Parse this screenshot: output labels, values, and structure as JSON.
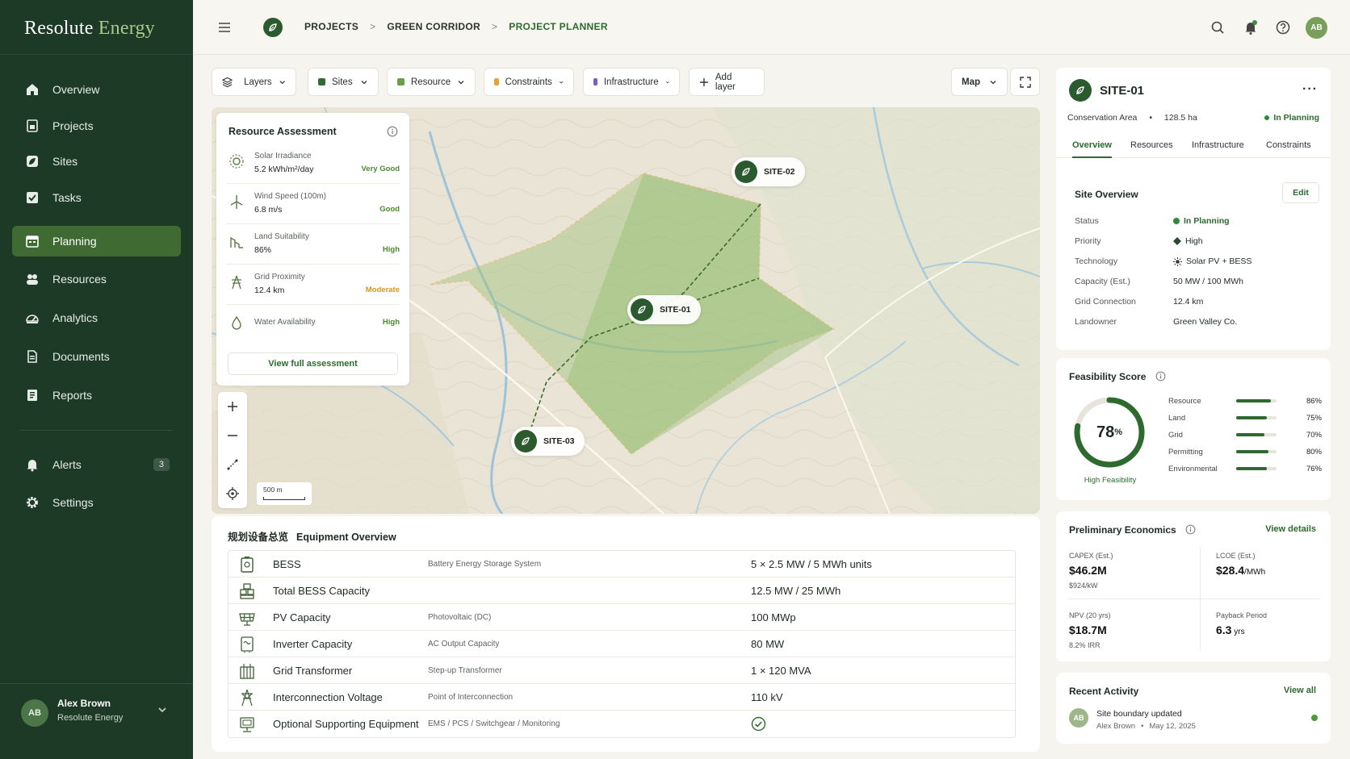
{
  "brand": {
    "name": "Resolute",
    "accent": "Energy"
  },
  "sidebar": {
    "items": [
      {
        "label": "Overview",
        "icon": "home-icon"
      },
      {
        "label": "Projects",
        "icon": "folder-icon"
      },
      {
        "label": "Sites",
        "icon": "leaf-icon"
      },
      {
        "label": "Tasks",
        "icon": "checkbox-icon"
      },
      {
        "label": "Planning",
        "icon": "calendar-icon",
        "active": true
      },
      {
        "label": "Resources",
        "icon": "people-icon"
      },
      {
        "label": "Analytics",
        "icon": "gauge-icon"
      },
      {
        "label": "Documents",
        "icon": "document-icon"
      },
      {
        "label": "Reports",
        "icon": "report-icon"
      }
    ],
    "alerts": {
      "label": "Alerts",
      "count": "3"
    },
    "settings": {
      "label": "Settings"
    },
    "user": {
      "initials": "AB",
      "name": "Alex Brown",
      "org": "Resolute Energy"
    }
  },
  "breadcrumb": {
    "items": [
      "PROJECTS",
      "GREEN CORRIDOR",
      "PROJECT PLANNER"
    ],
    "separator": ">"
  },
  "top": {
    "avatar": "AB"
  },
  "toolbar": {
    "layers": "Layers",
    "filters": [
      {
        "label": "Sites",
        "color": "#2f6b33"
      },
      {
        "label": "Resource",
        "color": "#6a9e4a"
      },
      {
        "label": "Constraints",
        "color": "#e0a53a"
      },
      {
        "label": "Infrastructure",
        "color": "#7b5bc7"
      }
    ],
    "add_layer": "Add layer",
    "view": "Map"
  },
  "resource_assessment": {
    "title": "Resource Assessment",
    "rows": [
      {
        "name": "Solar Irradiance",
        "value": "5.2 kWh/m²/day",
        "status": "Very Good",
        "color": "#4a8a2c"
      },
      {
        "name": "Wind Speed (100m)",
        "value": "6.8 m/s",
        "status": "Good",
        "color": "#4a8a2c"
      },
      {
        "name": "Land Suitability",
        "value": "86%",
        "status": "High",
        "color": "#4a8a2c"
      },
      {
        "name": "Grid Proximity",
        "value": "12.4 km",
        "status": "Moderate",
        "color": "#d9951c"
      },
      {
        "name": "Water Availability",
        "value": "",
        "status": "High",
        "color": "#4a8a2c"
      }
    ],
    "button": "View full assessment"
  },
  "map": {
    "scale": "500 m",
    "pins": [
      "SITE-02",
      "SITE-01",
      "SITE-03"
    ]
  },
  "equipment": {
    "title_cn": "规划设备总览",
    "title": "Equipment Overview",
    "rows": [
      {
        "name": "BESS",
        "desc": "Battery Energy Storage System",
        "value": "5 × 2.5 MW / 5 MWh units"
      },
      {
        "name": "Total BESS Capacity",
        "desc": "",
        "value": "12.5 MW / 25 MWh"
      },
      {
        "name": "PV Capacity",
        "desc": "Photovoltaic (DC)",
        "value": "100 MWp"
      },
      {
        "name": "Inverter Capacity",
        "desc": "AC Output Capacity",
        "value": "80 MW"
      },
      {
        "name": "Grid Transformer",
        "desc": "Step-up Transformer",
        "value": "1 × 120 MVA"
      },
      {
        "name": "Interconnection Voltage",
        "desc": "Point of Interconnection",
        "value": "110 kV"
      },
      {
        "name": "Optional Supporting Equipment",
        "desc": "EMS / PCS / Switchgear / Monitoring",
        "value": ""
      }
    ]
  },
  "site": {
    "name": "SITE-01",
    "area_type": "Conservation Area",
    "dot": "•",
    "size": "128.5 ha",
    "status": "In Planning",
    "tabs": [
      "Overview",
      "Resources",
      "Infrastructure",
      "Constraints"
    ],
    "overview_title": "Site Overview",
    "edit": "Edit",
    "fields": [
      {
        "k": "Status",
        "v": "In Planning"
      },
      {
        "k": "Priority",
        "v": "High"
      },
      {
        "k": "Technology",
        "v": "Solar PV + BESS"
      },
      {
        "k": "Capacity (Est.)",
        "v": "50 MW / 100 MWh"
      },
      {
        "k": "Grid Connection",
        "v": "12.4 km"
      },
      {
        "k": "Landowner",
        "v": "Green Valley Co."
      }
    ]
  },
  "feasibility": {
    "title": "Feasibility Score",
    "score": "78",
    "unit": "%",
    "score_value": 78,
    "caption": "High Feasibility",
    "rows": [
      {
        "label": "Resource",
        "pct": "86%",
        "value": 86
      },
      {
        "label": "Land",
        "pct": "75%",
        "value": 75
      },
      {
        "label": "Grid",
        "pct": "70%",
        "value": 70
      },
      {
        "label": "Permitting",
        "pct": "80%",
        "value": 80
      },
      {
        "label": "Environmental",
        "pct": "76%",
        "value": 76
      }
    ]
  },
  "economics": {
    "title": "Preliminary Economics",
    "link": "View details",
    "capex": {
      "label": "CAPEX (Est.)",
      "value": "$46.2M",
      "sub": "$924/kW"
    },
    "lcoe": {
      "label": "LCOE (Est.)",
      "value": "$28.4",
      "unit": "/MWh"
    },
    "npv": {
      "label": "NPV (20 yrs)",
      "value": "$18.7M",
      "sub": "8.2% IRR"
    },
    "payback": {
      "label": "Payback Period",
      "value": "6.3",
      "unit": " yrs"
    }
  },
  "activity": {
    "title": "Recent Activity",
    "link": "View all",
    "item": {
      "initials": "AB",
      "text": "Site boundary updated",
      "who": "Alex Brown",
      "sep": "•",
      "when": "May 12, 2025"
    }
  }
}
